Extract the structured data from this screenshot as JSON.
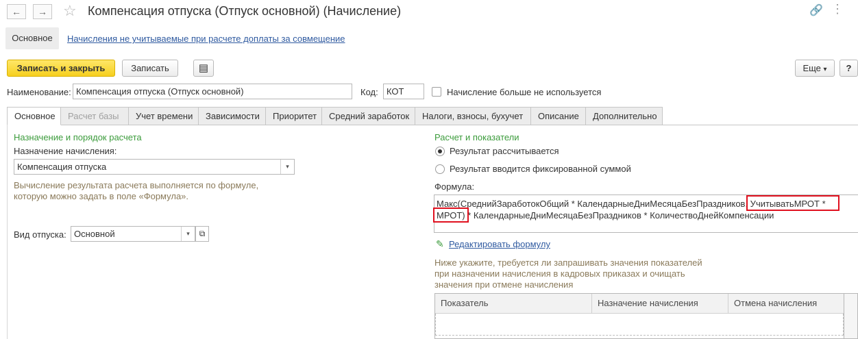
{
  "window": {
    "title": "Компенсация отпуска (Отпуск основной) (Начисление)",
    "back_icon": "←",
    "forward_icon": "→",
    "star_icon": "☆",
    "link_icon": "🔗",
    "more_icon": "⋮"
  },
  "sections": {
    "active": "Основное",
    "link": "Начисления не учитываемые при расчете доплаты за совмещение"
  },
  "toolbar": {
    "save_close": "Записать и закрыть",
    "save": "Записать",
    "list_icon": "▤",
    "more": "Еще",
    "more_arrow": "▾",
    "help": "?"
  },
  "header_fields": {
    "name_label": "Наименование:",
    "name_value": "Компенсация отпуска (Отпуск основной)",
    "code_label": "Код:",
    "code_value": "КОТ",
    "unused_label": "Начисление больше не используется"
  },
  "tabs": [
    {
      "label": "Основное"
    },
    {
      "label": "Расчет базы"
    },
    {
      "label": "Учет времени"
    },
    {
      "label": "Зависимости"
    },
    {
      "label": "Приоритет"
    },
    {
      "label": "Средний заработок"
    },
    {
      "label": "Налоги, взносы, бухучет"
    },
    {
      "label": "Описание"
    },
    {
      "label": "Дополнительно"
    }
  ],
  "left": {
    "section_title": "Назначение и порядок расчета",
    "purpose_label": "Назначение начисления:",
    "purpose_value": "Компенсация отпуска",
    "hint_line1": "Вычисление результата расчета выполняется по формуле,",
    "hint_line2": "которую можно задать в поле «Формула».",
    "vacation_label": "Вид отпуска:",
    "vacation_value": "Основной",
    "dropdown_arrow": "▾",
    "open_icon": "⧉"
  },
  "right": {
    "section_title": "Расчет и показатели",
    "radio_calc": "Результат рассчитывается",
    "radio_fixed": "Результат вводится фиксированной суммой",
    "formula_label": "Формула:",
    "formula_line1": "Макс(СреднийЗаработокОбщий * КалендарныеДниМесяцаБезПраздников, УчитыватьМРОТ *",
    "formula_line2": "МРОТ) * КалендарныеДниМесяцаБезПраздников * КоличествоДнейКомпенсации",
    "edit_icon": "✎",
    "edit_link": "Редактировать формулу",
    "note_line1": "Ниже укажите, требуется ли запрашивать значения показателей",
    "note_line2": "при назначении начисления в кадровых приказах и очищать",
    "note_line3": "значения при отмене начисления",
    "grid_columns": [
      "Показатель",
      "Назначение начисления",
      "Отмена начисления"
    ]
  },
  "colors": {
    "accent_green": "#3b9b3b",
    "link_blue": "#2f5aa0",
    "primary_yellow": "#f6cf1f",
    "highlight_red": "#e0101e"
  }
}
